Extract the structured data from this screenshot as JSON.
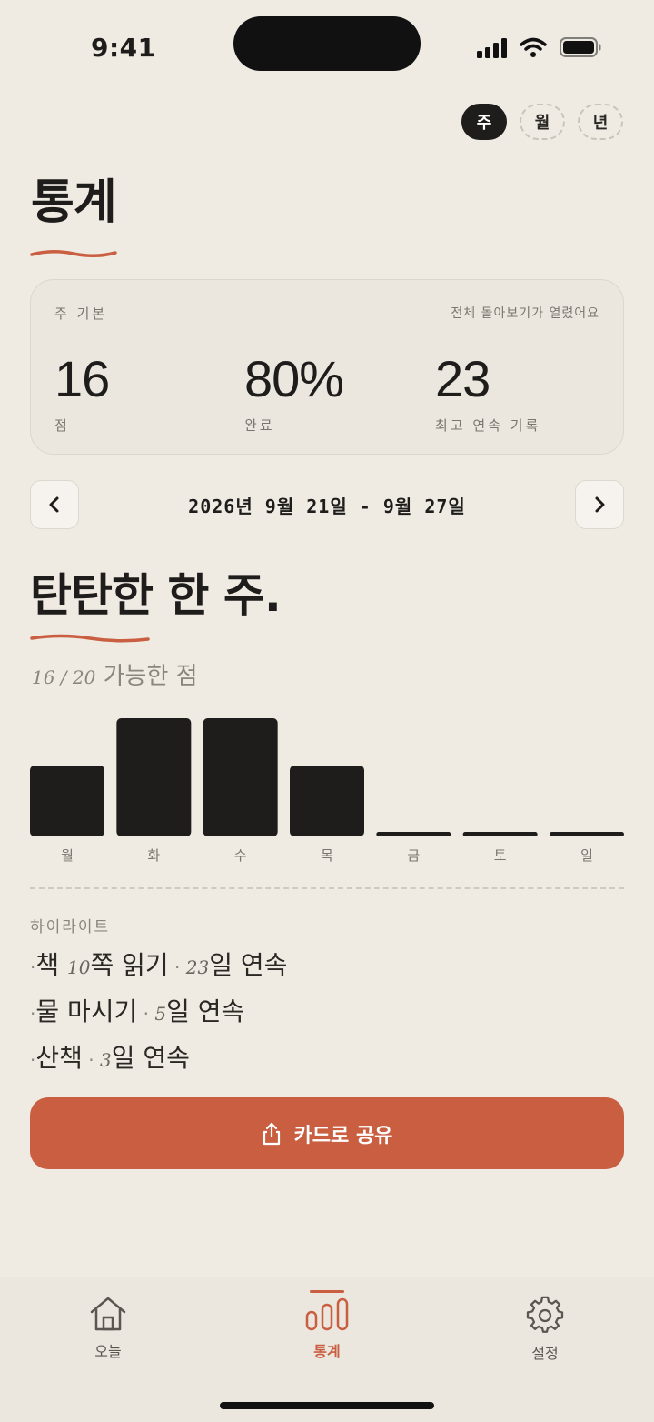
{
  "status": {
    "time": "9:41"
  },
  "period": {
    "options": [
      "주",
      "월",
      "년"
    ],
    "selected": "주"
  },
  "page": {
    "title": "통계"
  },
  "summary": {
    "label": "주 기본",
    "note": "전체 돌아보기가 열렸어요",
    "stats": [
      {
        "value": "16",
        "caption": "점"
      },
      {
        "value": "80%",
        "caption": "완료"
      },
      {
        "value": "23",
        "caption": "최고 연속 기록"
      }
    ]
  },
  "date_nav": {
    "range": "2026년 9월 21일 - 9월 27일"
  },
  "headline": "탄탄한 한 주.",
  "score": {
    "earned": "16",
    "sep": " / ",
    "possible": "20",
    "suffix": " 가능한 점"
  },
  "chart_data": {
    "type": "bar",
    "categories": [
      "월",
      "화",
      "수",
      "목",
      "금",
      "토",
      "일"
    ],
    "values": [
      3,
      5,
      5,
      3,
      0,
      0,
      0
    ],
    "ylim": [
      0,
      5
    ],
    "grid": false,
    "bar_color": "#1f1d1b"
  },
  "highlights": {
    "title": "하이라이트",
    "items": [
      {
        "bullet": "·",
        "name": "책 ",
        "hand": "10",
        "name_rest": "쪽 읽기",
        "sep": " · ",
        "streak_num": "23",
        "streak_text": "일 연속"
      },
      {
        "bullet": "·",
        "name": "물 마시기",
        "hand": "",
        "name_rest": "",
        "sep": " · ",
        "streak_num": "5",
        "streak_text": "일 연속"
      },
      {
        "bullet": "·",
        "name": "산책",
        "hand": "",
        "name_rest": "",
        "sep": " · ",
        "streak_num": "3",
        "streak_text": "일 연속"
      }
    ]
  },
  "share": {
    "label": "카드로 공유"
  },
  "tabs": [
    {
      "label": "오늘",
      "icon": "home-icon"
    },
    {
      "label": "통계",
      "icon": "bar-chart-icon",
      "active": true
    },
    {
      "label": "설정",
      "icon": "gear-icon"
    }
  ],
  "colors": {
    "accent": "#c95f40",
    "background": "#efebe3",
    "ink": "#1f1d1b"
  }
}
